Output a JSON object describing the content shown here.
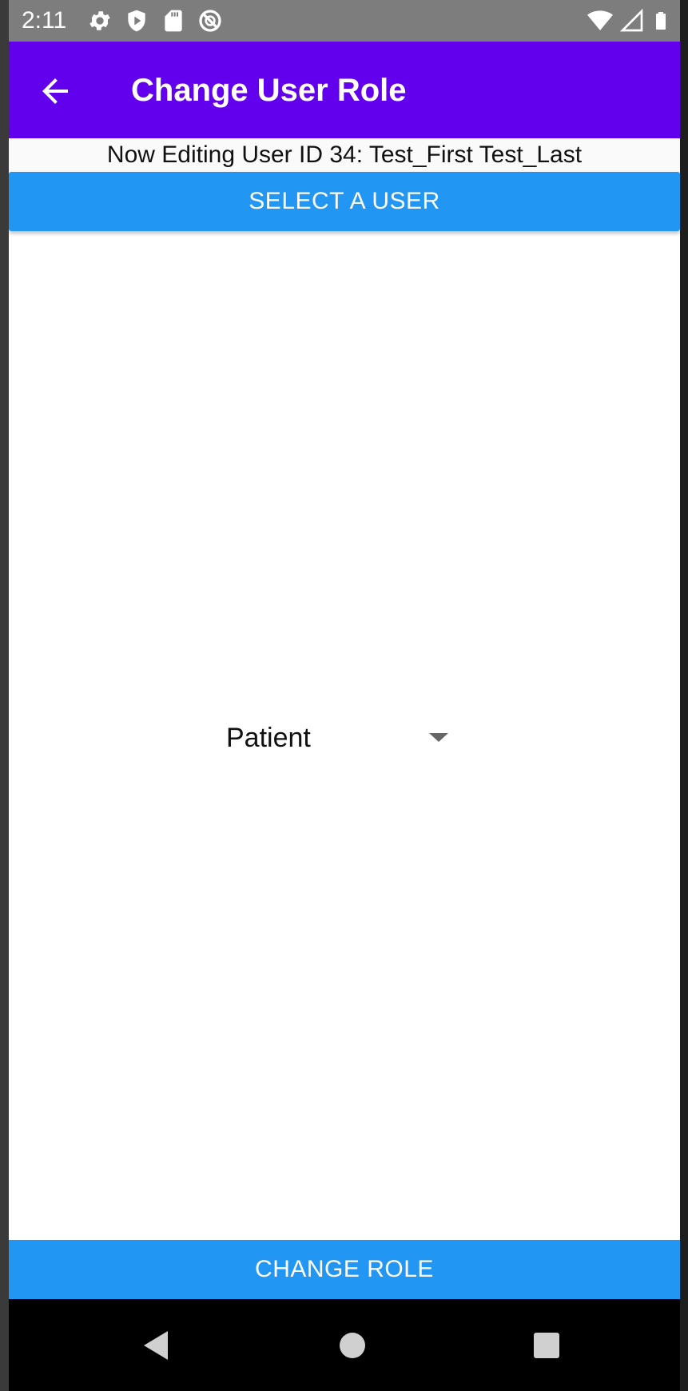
{
  "status_bar": {
    "time": "2:11",
    "left_icons": [
      "gear-icon",
      "play-protect-icon",
      "sd-card-icon",
      "no-disturb-icon"
    ],
    "right_icons": [
      "wifi-icon",
      "cell-signal-icon",
      "battery-icon"
    ],
    "background": "#7d7d7d"
  },
  "app_bar": {
    "title": "Change User Role",
    "back_icon": "arrow-left-icon",
    "background": "#6200ee"
  },
  "editing": {
    "label": "Now Editing User ID 34: Test_First Test_Last"
  },
  "select_user": {
    "label": "SELECT A USER",
    "color": "#2196f3"
  },
  "role_select": {
    "selected": "Patient",
    "icon": "caret-down-icon"
  },
  "change_role": {
    "label": "CHANGE ROLE",
    "color": "#2196f3"
  },
  "nav_bar": {
    "buttons": [
      "back-triangle-icon",
      "home-circle-icon",
      "recents-square-icon"
    ]
  }
}
